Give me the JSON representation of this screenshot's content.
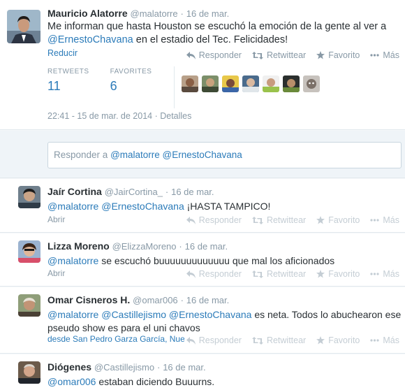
{
  "actions": {
    "reply": "Responder",
    "retweet": "Retwittear",
    "favorite": "Favorito",
    "more": "Más"
  },
  "main": {
    "name": "Mauricio Alatorre",
    "handle": "@malatorre",
    "dot": "·",
    "time": "16 de mar.",
    "text_before": "Me informan que hasta Houston se escuchó la emoción de la gente al ver a ",
    "mention": "@ErnestoChavana",
    "text_after": " en el estadio del Tec. Felicidades!",
    "collapse": "Reducir",
    "retweets_label": "RETWEETS",
    "retweets_count": "11",
    "favorites_label": "FAVORITES",
    "favorites_count": "6",
    "datetime": "22:41 - 15 de mar. de 2014 · Detalles"
  },
  "reply_box": {
    "placeholder_prefix": "Responder a ",
    "mentions": "@malatorre @ErnestoChavana"
  },
  "replies": [
    {
      "name": "Jaír Cortina",
      "handle": "@JairCortina_",
      "dot": "·",
      "time": "16 de mar.",
      "parts": [
        {
          "t": "@malatorre",
          "link": true
        },
        {
          "t": " ",
          "link": false
        },
        {
          "t": "@ErnestoChavana",
          "link": true
        },
        {
          "t": " ¡HASTA TAMPICO!",
          "link": false
        }
      ],
      "sub": "Abrir"
    },
    {
      "name": "Lizza Moreno",
      "handle": "@ElizzaMoreno",
      "dot": "·",
      "time": "16 de mar.",
      "parts": [
        {
          "t": "@malatorre",
          "link": true
        },
        {
          "t": " se escuchó buuuuuuuuuuuuu que mal los aficionados",
          "link": false
        }
      ],
      "sub": "Abrir"
    },
    {
      "name": "Omar Cisneros H.",
      "handle": "@omar006",
      "dot": "·",
      "time": "16 de mar.",
      "parts": [
        {
          "t": "@malatorre",
          "link": true
        },
        {
          "t": " ",
          "link": false
        },
        {
          "t": "@Castillejismo",
          "link": true
        },
        {
          "t": " ",
          "link": false
        },
        {
          "t": "@ErnestoChavana",
          "link": true
        },
        {
          "t": " es neta. Todos lo abuchearon ese pseudo show es para el uni chavos",
          "link": false
        }
      ],
      "sub": "desde San Pedro Garza García, Nue"
    },
    {
      "name": "Diógenes",
      "handle": "@Castillejismo",
      "dot": "·",
      "time": "16 de mar.",
      "parts": [
        {
          "t": "@omar006",
          "link": true
        },
        {
          "t": " estaban diciendo Buuurns.",
          "link": false
        }
      ],
      "sub": ""
    }
  ]
}
